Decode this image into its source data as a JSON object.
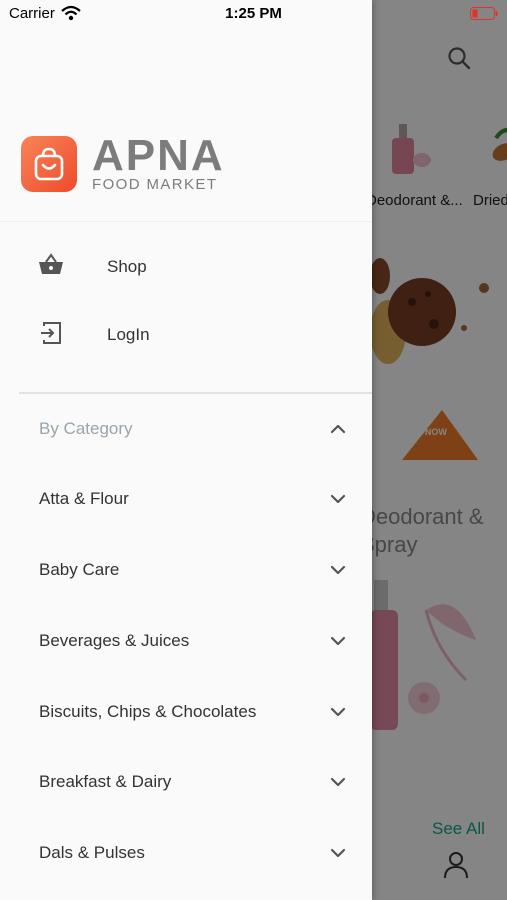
{
  "status_bar": {
    "carrier": "Carrier",
    "time": "1:25 PM",
    "battery_color": "#e3322b"
  },
  "drawer": {
    "brand": {
      "name": "APNA",
      "subtitle": "FOOD MARKET",
      "icon": "shopping-bag-icon",
      "gradient": [
        "#f7845a",
        "#ef4b2b"
      ]
    },
    "menu": [
      {
        "label": "Shop",
        "icon": "basket-icon"
      },
      {
        "label": "LogIn",
        "icon": "login-icon"
      }
    ],
    "category_header": "By Category",
    "categories": [
      {
        "label": "Atta & Flour"
      },
      {
        "label": "Baby Care"
      },
      {
        "label": "Beverages & Juices"
      },
      {
        "label": "Biscuits, Chips & Chocolates"
      },
      {
        "label": "Breakfast & Dairy"
      },
      {
        "label": "Dals & Pulses"
      }
    ]
  },
  "background": {
    "category_labels": [
      "Deodorant &...",
      "Dried"
    ],
    "banner_cta": "SHOP NOW",
    "section_title_lines": [
      "Deodorant &",
      "Spray"
    ],
    "see_all": "See All",
    "accent_color": "#11a88f",
    "banner_accent": "#f07d2a"
  }
}
